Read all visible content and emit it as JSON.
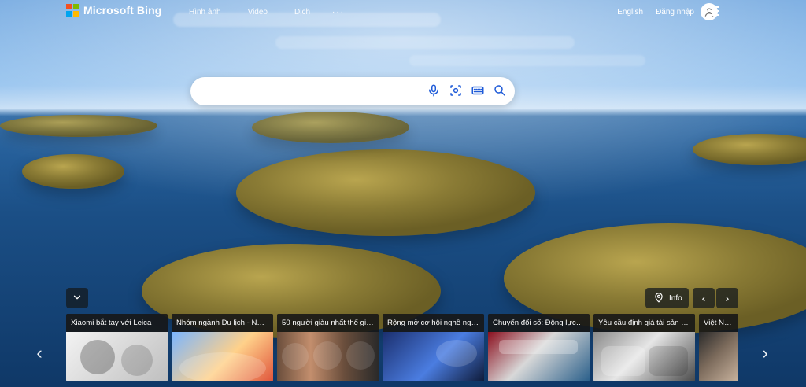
{
  "brand": {
    "name": "Microsoft Bing"
  },
  "header": {
    "nav": [
      {
        "label": "Hình ảnh"
      },
      {
        "label": "Video"
      },
      {
        "label": "Dịch"
      },
      {
        "label": "···"
      }
    ],
    "language_label": "English",
    "signin_label": "Đăng nhập"
  },
  "search": {
    "value": "",
    "placeholder": ""
  },
  "controls": {
    "collapse_icon": "chevron-down-icon",
    "info_label": "Info",
    "info_icon": "map-pin-icon",
    "prev_icon": "chevron-left-icon",
    "next_icon": "chevron-right-icon"
  },
  "carousel": {
    "items": [
      {
        "title": "Xiaomi bắt tay với Leica"
      },
      {
        "title": "Nhóm ngành Du lịch - Nhà..."
      },
      {
        "title": "50 người giàu nhất thế giới..."
      },
      {
        "title": "Rộng mở cơ hội nghề nghi..."
      },
      {
        "title": "Chuyển đổi số: Động lực c..."
      },
      {
        "title": "Yêu cầu định giá tài sản thi..."
      },
      {
        "title": "Việt Nam t"
      }
    ]
  },
  "colors": {
    "ms_red": "#f25022",
    "ms_green": "#7fba00",
    "ms_blue": "#00a4ef",
    "ms_yellow": "#ffb900"
  }
}
